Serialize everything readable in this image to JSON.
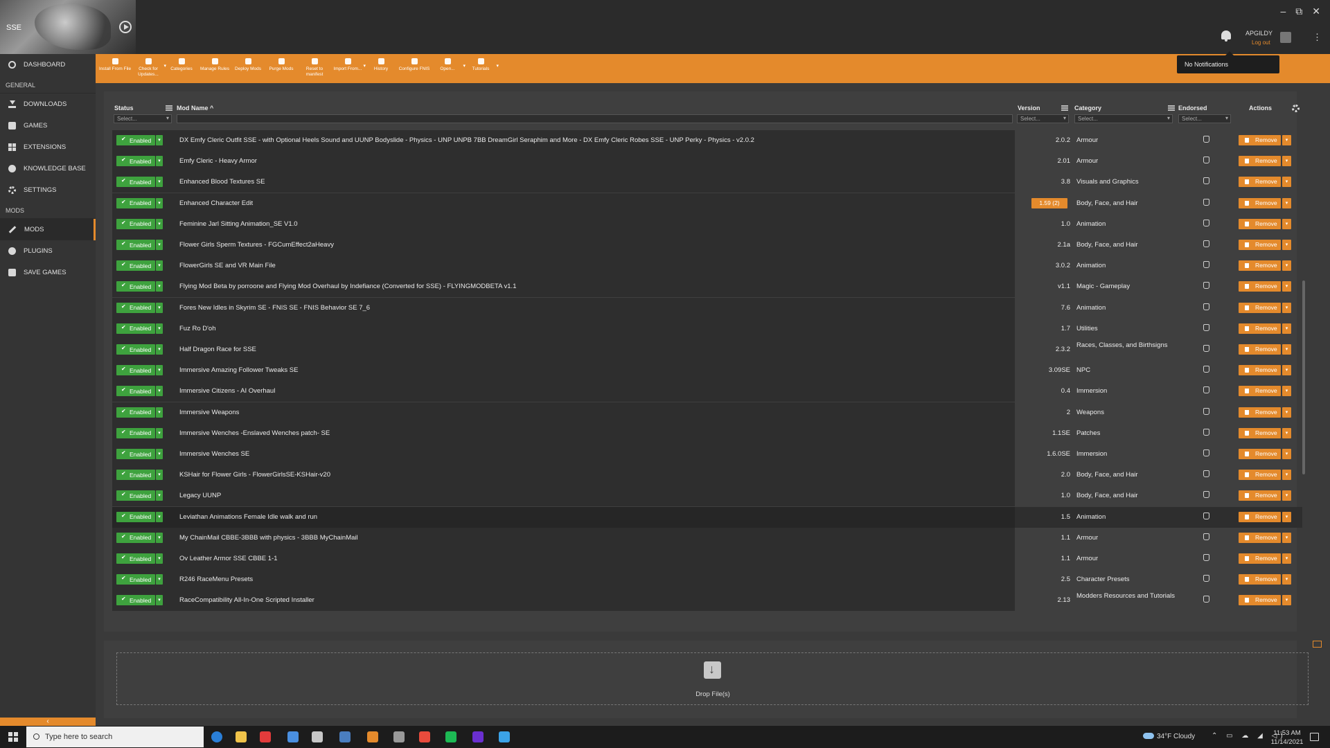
{
  "window": {
    "game_label": "SSE",
    "minimize": "–",
    "restore": "⧉",
    "close": "✕"
  },
  "user": {
    "name": "APGILDY",
    "logout": "Log out"
  },
  "notifications": {
    "popup_text": "No Notifications"
  },
  "sidebar": {
    "items_top": [
      {
        "label": "DASHBOARD",
        "icon": "gauge-icon"
      }
    ],
    "general_label": "GENERAL",
    "items_general": [
      {
        "label": "DOWNLOADS",
        "icon": "download-icon"
      },
      {
        "label": "GAMES",
        "icon": "gamepad-icon"
      },
      {
        "label": "EXTENSIONS",
        "icon": "grid-icon"
      },
      {
        "label": "KNOWLEDGE BASE",
        "icon": "info-icon"
      },
      {
        "label": "SETTINGS",
        "icon": "gear-icon"
      }
    ],
    "mods_label": "MODS",
    "items_mods": [
      {
        "label": "MODS",
        "icon": "pencil-icon",
        "active": true
      },
      {
        "label": "PLUGINS",
        "icon": "plugin-icon"
      },
      {
        "label": "SAVE GAMES",
        "icon": "save-icon"
      }
    ],
    "collapse": "‹"
  },
  "toolbar": [
    {
      "label": "Install From File",
      "icon": "install-icon"
    },
    {
      "label": "Check for Updates...",
      "icon": "refresh-icon",
      "caret": true
    },
    {
      "label": "Categories",
      "icon": "tag-icon"
    },
    {
      "label": "Manage Rules",
      "icon": "rules-icon"
    },
    {
      "label": "Deploy Mods",
      "icon": "link-icon"
    },
    {
      "label": "Purge Mods",
      "icon": "unlink-icon"
    },
    {
      "label": "Reset to manifest",
      "icon": "reset-icon"
    },
    {
      "label": "Import From...",
      "icon": "import-icon",
      "caret": true
    },
    {
      "label": "History",
      "icon": "history-icon"
    },
    {
      "label": "Configure FNIS",
      "icon": "configure-icon"
    },
    {
      "label": "Open...",
      "icon": "folder-icon",
      "caret": true
    },
    {
      "label": "Tutorials",
      "icon": "video-icon",
      "caret": true
    }
  ],
  "table": {
    "headers": {
      "status": "Status",
      "mod_name": "Mod Name ^",
      "version": "Version",
      "category": "Category",
      "endorsed": "Endorsed",
      "actions": "Actions"
    },
    "filter_placeholder": "Select...",
    "status_label": "Enabled",
    "remove_label": "Remove",
    "rows": [
      {
        "name": "DX Emfy Cleric Outfit SSE - with Optional Heels Sound and UUNP Bodyslide - Physics - UNP UNPB 7BB DreamGirl Seraphim and More - DX Emfy Cleric Robes SSE - UNP Perky - Physics - v2.0.2",
        "version": "2.0.2",
        "category": "Armour"
      },
      {
        "name": "Emfy Cleric - Heavy Armor",
        "version": "2.01",
        "category": "Armour"
      },
      {
        "name": "Enhanced Blood Textures SE",
        "version": "3.8",
        "category": "Visuals and Graphics"
      },
      {
        "name": "Enhanced Character Edit",
        "version": "1.59 (2)",
        "badge": true,
        "category": "Body, Face, and Hair"
      },
      {
        "name": "Feminine Jarl Sitting Animation_SE V1.0",
        "version": "1.0",
        "category": "Animation"
      },
      {
        "name": "Flower Girls Sperm Textures - FGCumEffect2aHeavy",
        "version": "2.1a",
        "category": "Body, Face, and Hair"
      },
      {
        "name": "FlowerGirls SE and VR Main File",
        "version": "3.0.2",
        "category": "Animation"
      },
      {
        "name": "Flying Mod Beta by porroone and Flying Mod Overhaul by Indefiance (Converted for SSE) - FLYINGMODBETA v1.1",
        "version": "v1.1",
        "category": "Magic - Gameplay"
      },
      {
        "name": "Fores New Idles in Skyrim SE - FNIS SE - FNIS Behavior SE 7_6",
        "version": "7.6",
        "category": "Animation"
      },
      {
        "name": "Fuz Ro D'oh",
        "version": "1.7",
        "category": "Utilities"
      },
      {
        "name": "Half Dragon Race for SSE",
        "version": "2.3.2",
        "category": "Races, Classes, and Birthsigns"
      },
      {
        "name": "Immersive Amazing Follower Tweaks SE",
        "version": "3.09SE",
        "category": "NPC"
      },
      {
        "name": "Immersive Citizens - AI Overhaul",
        "version": "0.4",
        "category": "Immersion"
      },
      {
        "name": "Immersive Weapons",
        "version": "2",
        "category": "Weapons"
      },
      {
        "name": "Immersive Wenches -Enslaved Wenches patch- SE",
        "version": "1.1SE",
        "category": "Patches"
      },
      {
        "name": "Immersive Wenches SE",
        "version": "1.6.0SE",
        "category": "Immersion"
      },
      {
        "name": "KSHair for Flower Girls - FlowerGirlsSE-KSHair-v20",
        "version": "2.0",
        "category": "Body, Face, and Hair"
      },
      {
        "name": "Legacy UUNP",
        "version": "1.0",
        "category": "Body, Face, and Hair"
      },
      {
        "name": "Leviathan Animations Female Idle walk and run",
        "version": "1.5",
        "category": "Animation",
        "highlight": true
      },
      {
        "name": "My ChainMail CBBE-3BBB with physics - 3BBB MyChainMail",
        "version": "1.1",
        "category": "Armour"
      },
      {
        "name": "Ov Leather Armor SSE CBBE 1-1",
        "version": "1.1",
        "category": "Armour"
      },
      {
        "name": "R246 RaceMenu Presets",
        "version": "2.5",
        "category": "Character Presets"
      },
      {
        "name": "RaceCompatibility All-In-One Scripted Installer",
        "version": "2.13",
        "category": "Modders Resources and Tutorials"
      }
    ]
  },
  "dropzone": {
    "label": "Drop File(s)"
  },
  "taskbar": {
    "search_placeholder": "Type here to search",
    "weather": "34°F  Cloudy",
    "time": "11:53 AM",
    "date": "11/14/2021",
    "app_colors": [
      "#2a7fd8",
      "#f0c34a",
      "#e23b3b",
      "#4a8fe0",
      "#c7c7c7",
      "#4a7ec0",
      "#e48a2c",
      "#999999",
      "#e94b3c",
      "#1db954",
      "#6a2fd0",
      "#3ba3e8"
    ]
  }
}
